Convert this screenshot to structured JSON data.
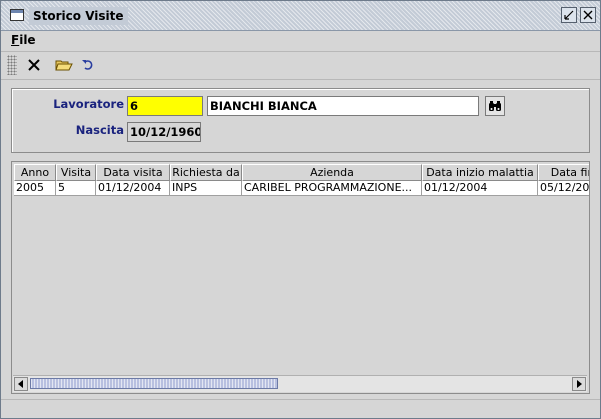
{
  "window": {
    "title": "Storico Visite"
  },
  "menu": {
    "file_label": "File"
  },
  "toolbar": {
    "icons": [
      "delete-icon",
      "open-folder-icon",
      "undo-icon"
    ]
  },
  "form": {
    "lavoratore_label": "Lavoratore",
    "lavoratore_code": "6",
    "lavoratore_name": "BIANCHI BIANCA",
    "nascita_label": "Nascita",
    "nascita_value": "10/12/1960"
  },
  "table": {
    "headers": [
      "Anno",
      "Visita",
      "Data visita",
      "Richiesta da",
      "Azienda",
      "Data inizio malattia",
      "Data fine"
    ],
    "rows": [
      [
        "2005",
        "5",
        "01/12/2004",
        "INPS",
        "CARIBEL PROGRAMMAZIONE...",
        "01/12/2004",
        "05/12/20"
      ]
    ]
  },
  "colors": {
    "title_bar": "#c3cbd6",
    "code_field_bg": "#ffff00",
    "label_text": "#1a237e",
    "panel_bg": "#d6d6d6"
  }
}
